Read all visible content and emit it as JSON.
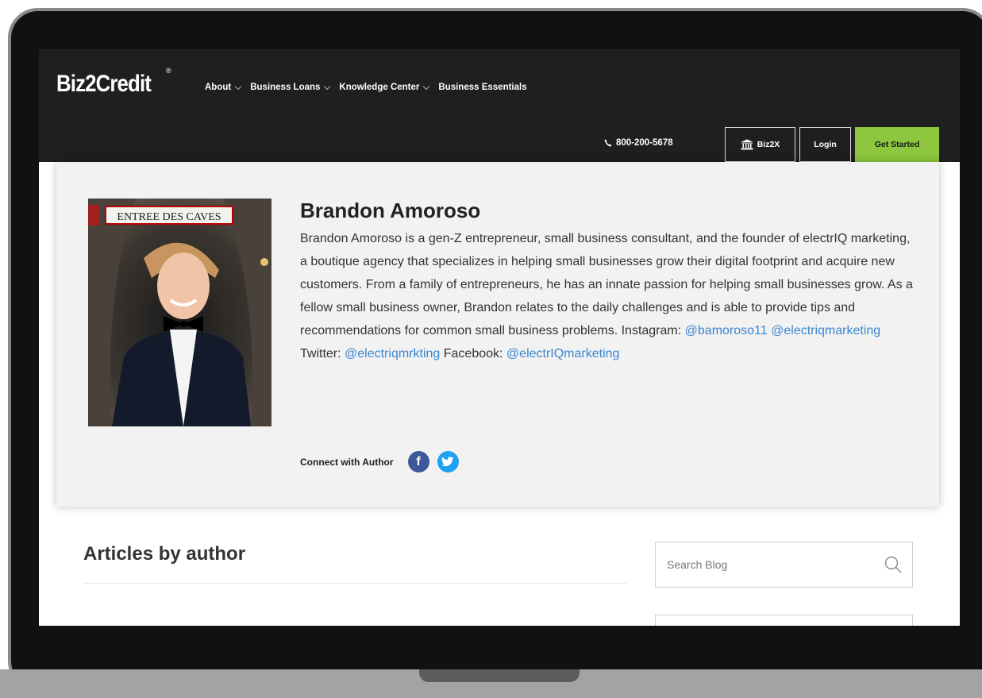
{
  "header": {
    "logo": "Biz2Credit",
    "logo_mark": "®",
    "nav": [
      {
        "label": "About",
        "dropdown": true
      },
      {
        "label": "Business Loans",
        "dropdown": true
      },
      {
        "label": "Knowledge Center",
        "dropdown": true
      },
      {
        "label": "Business Essentials",
        "dropdown": false
      }
    ],
    "phone": "800-200-5678",
    "phone_icon": "phone-icon",
    "biz2x_label": "Biz2X",
    "biz2x_icon": "bank-icon",
    "login_label": "Login",
    "get_started_label": "Get Started",
    "accent_color": "#8dc63f"
  },
  "author": {
    "name": "Brandon Amoroso",
    "photo_sign": "ENTREE DES CAVES",
    "bio_text": "Brandon Amoroso is a gen-Z entrepreneur, small business consultant, and the founder of electrIQ marketing, a boutique agency that specializes in helping small businesses grow their digital footprint and acquire new customers. From a family of entrepreneurs, he has an innate passion for helping small businesses grow. As a fellow small business owner, Brandon relates to the daily challenges and is able to provide tips and recommendations for common small business problems.",
    "instagram_label": "Instagram:",
    "instagram_1": "@bamoroso11",
    "instagram_2": "@electriqmarketing",
    "twitter_label": "Twitter:",
    "twitter_handle": "@electriqmrkting",
    "facebook_label": "Facebook:",
    "facebook_handle": "@electrIQmarketing",
    "connect_label": "Connect with Author",
    "facebook_icon_letter": "f",
    "link_color": "#3b86d1"
  },
  "articles": {
    "title": "Articles by author"
  },
  "search": {
    "placeholder": "Search Blog",
    "icon": "search-icon"
  }
}
